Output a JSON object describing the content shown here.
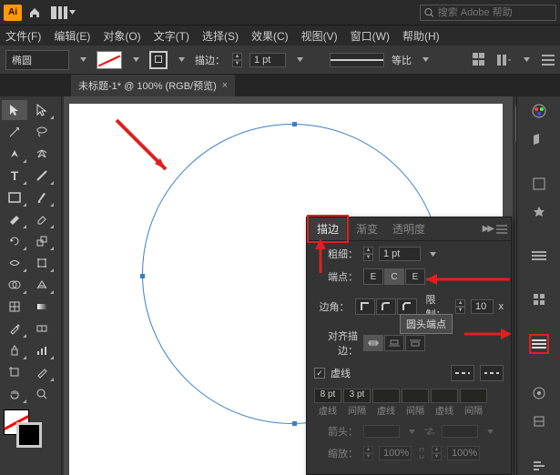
{
  "titlebar": {
    "logo": "Ai",
    "search_placeholder": "搜索 Adobe 帮助"
  },
  "menus": {
    "file": "文件(F)",
    "edit": "编辑(E)",
    "object": "对象(O)",
    "type": "文字(T)",
    "select": "选择(S)",
    "effect": "效果(C)",
    "view": "视图(V)",
    "window": "窗口(W)",
    "help": "帮助(H)"
  },
  "options": {
    "shape_name": "椭圆",
    "stroke_label": "描边：",
    "stroke_weight": "1 pt",
    "profile_label": "等比"
  },
  "document": {
    "tab_title": "未标题-1* @ 100% (RGB/预览)"
  },
  "stroke_panel": {
    "tab_stroke": "描边",
    "tab_gradient": "渐变",
    "tab_transparency": "透明度",
    "weight_label": "粗细：",
    "weight_value": "1 pt",
    "cap_label": "端点：",
    "cap_tooltip": "圆头端点",
    "corner_label": "边角：",
    "limit_label": "限制：",
    "limit_value": "10",
    "limit_suffix": "x",
    "align_label": "对齐描边：",
    "dashed_label": "虚线",
    "dash1": "8 pt",
    "gap1": "3 pt",
    "lbl_dash": "虚线",
    "lbl_gap": "间隔",
    "arrow_label": "箭头：",
    "scale_label": "缩放：",
    "scale_value": "100%"
  }
}
